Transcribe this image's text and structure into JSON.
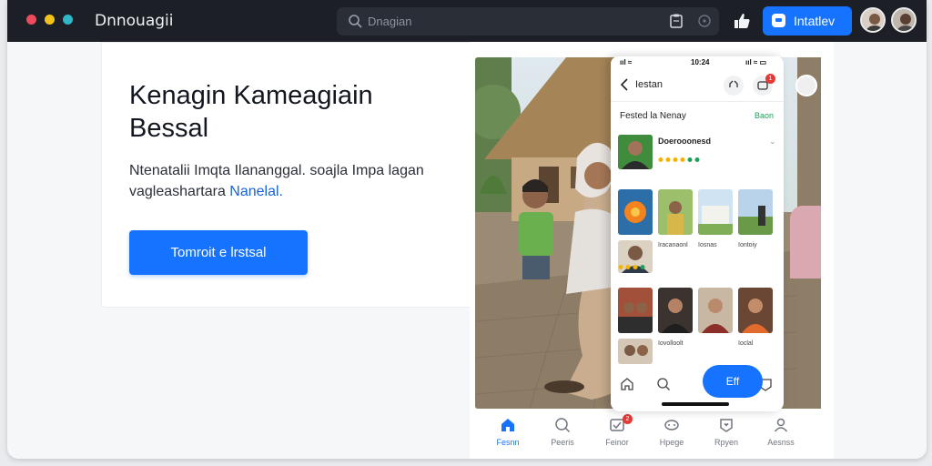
{
  "app": {
    "title": "Dnnouagii"
  },
  "search": {
    "placeholder": "Dnagian"
  },
  "topbar": {
    "primary_button": "Intatlev"
  },
  "hero": {
    "title": "Kenagin Kameagiain Bessal",
    "description": "Ntenatalii Imqta Ilananggal. soajla Impa lagan vagleashartara",
    "description_link": "Nanelal.",
    "button": "Tomroit e lrstsal"
  },
  "phone": {
    "status_time": "10:24",
    "status_left": "ııl ≈",
    "status_right": "ııl ≈ ▭",
    "header_title": "Iestan",
    "notification_count": "1",
    "section_title": "Fested la Nenay",
    "section_link": "Baon",
    "featured_name": "Doerooonesd",
    "tile_row2_labels": [
      "Iracanaonl",
      "Iosnas",
      "Iontoiy"
    ],
    "tile_row3_labels": [
      "Iovolloolt",
      "Ioclal"
    ],
    "fab_label": "Eff"
  },
  "tabbar": {
    "items": [
      {
        "label": "Fesnn",
        "icon": "home-icon",
        "active": true
      },
      {
        "label": "Peeris",
        "icon": "search-icon",
        "active": false
      },
      {
        "label": "Feinor",
        "icon": "inbox-icon",
        "active": false,
        "badge": "2"
      },
      {
        "label": "Hpege",
        "icon": "chat-icon",
        "active": false
      },
      {
        "label": "Rpyen",
        "icon": "heart-icon",
        "active": false
      },
      {
        "label": "Aesnss",
        "icon": "profile-icon",
        "active": false
      }
    ]
  },
  "colors": {
    "accent": "#1673ff",
    "topbar": "#1c1f26",
    "success": "#1ea05a",
    "badge": "#e53935"
  }
}
